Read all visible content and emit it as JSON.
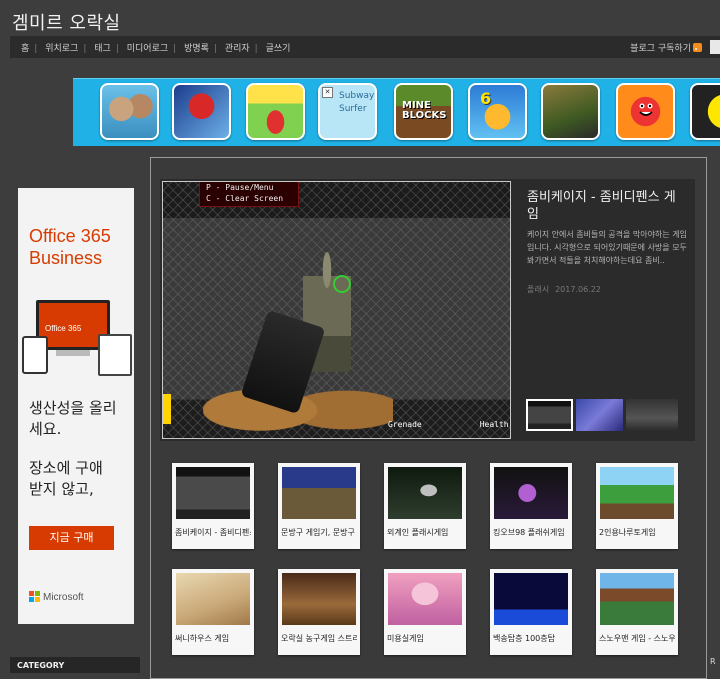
{
  "site": {
    "title": "겜미르 오락실"
  },
  "nav": {
    "links": [
      "홈",
      "위치로그",
      "태그",
      "미디어로그",
      "방명록",
      "관리자",
      "글쓰기"
    ],
    "subscribe_label": "블로그 구독하기"
  },
  "game_strip": {
    "icons": [
      {
        "name": "talking-tom-icon"
      },
      {
        "name": "spiderman-icon"
      },
      {
        "name": "wheely-icon"
      },
      {
        "name": "subway-surfer-icon",
        "alt_text": "Subway Surfer"
      },
      {
        "name": "mine-blocks-icon",
        "text": "MINE BLOCKS"
      },
      {
        "name": "pool-game-icon",
        "text": "6"
      },
      {
        "name": "temple-run-icon"
      },
      {
        "name": "red-ball-icon"
      },
      {
        "name": "pacman-icon"
      }
    ]
  },
  "ad": {
    "product": "Office 365 Business",
    "screen_text": "Office 365",
    "tagline": "생산성을 올리세요.",
    "tagline2": "장소에 구애받지 않고,",
    "button": "지금 구매",
    "brand": "Microsoft",
    "brand_colors": [
      "#f25022",
      "#7fba00",
      "#00a4ef",
      "#ffb900"
    ],
    "accent_color": "#d83b01"
  },
  "sidebar": {
    "category_label": "CATEGORY"
  },
  "featured": {
    "hud_line1": "P - Pause/Menu",
    "hud_line2": "C - Clear Screen",
    "hud_grenade": "Grenade",
    "hud_health": "Health",
    "title": "좀비케이지 - 좀비디펜스 게임",
    "description": "케이지 안에서 좀비들의 공격을 막아야하는 게임입니다. 시각형으로 되어있기때문에 사방을 모두 봐가면서 적들을 처치해야하는데요 좀비..",
    "category": "플래시",
    "date": "2017.06.22"
  },
  "cards": [
    {
      "label": "좀비케이지 - 좀비디펜스 게임"
    },
    {
      "label": "문방구 게임기, 문방구 게임"
    },
    {
      "label": "외계인 플래시게임"
    },
    {
      "label": "킹오브98 플래쉬게임"
    },
    {
      "label": "2인용나루토게임"
    },
    {
      "label": "써니하우스 게임"
    },
    {
      "label": "오락실 농구게임 스트리트"
    },
    {
      "label": "미용실게임"
    },
    {
      "label": "백송탑층 100층탑"
    },
    {
      "label": "스노우맨 게임 - 스노우"
    }
  ],
  "right_edge_label": "R"
}
